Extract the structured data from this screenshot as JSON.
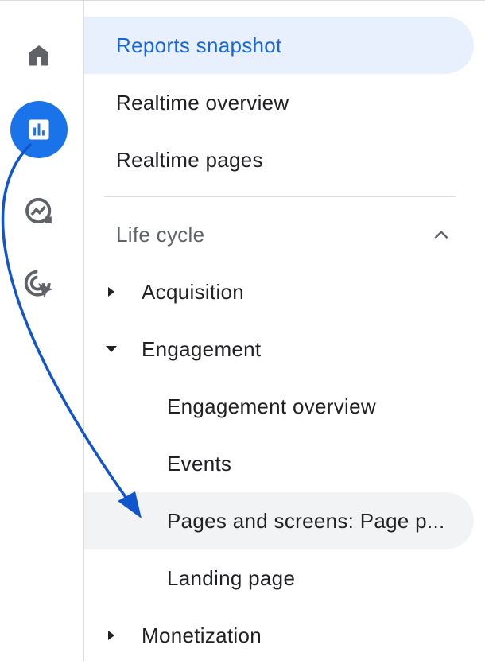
{
  "rail": {
    "items": [
      {
        "name": "home",
        "icon": "home-icon",
        "active": false
      },
      {
        "name": "reports",
        "icon": "bar-chart-icon",
        "active": true
      },
      {
        "name": "explore",
        "icon": "explore-trend-icon",
        "active": false
      },
      {
        "name": "advertising",
        "icon": "target-cursor-icon",
        "active": false
      }
    ],
    "accent": "#1a73e8"
  },
  "nav": {
    "reports_snapshot": "Reports snapshot",
    "realtime_overview": "Realtime overview",
    "realtime_pages": "Realtime pages",
    "section_title": "Life cycle",
    "acquisition": "Acquisition",
    "engagement": "Engagement",
    "engagement_overview": "Engagement overview",
    "events": "Events",
    "pages_and_screens": "Pages and screens: Page p...",
    "landing_page": "Landing page",
    "monetization": "Monetization"
  },
  "colors": {
    "selected_bg": "#e8f0fe",
    "selected_text": "#1967d2",
    "hover_bg": "#f1f3f4",
    "annotation_arrow": "#1155cc"
  }
}
